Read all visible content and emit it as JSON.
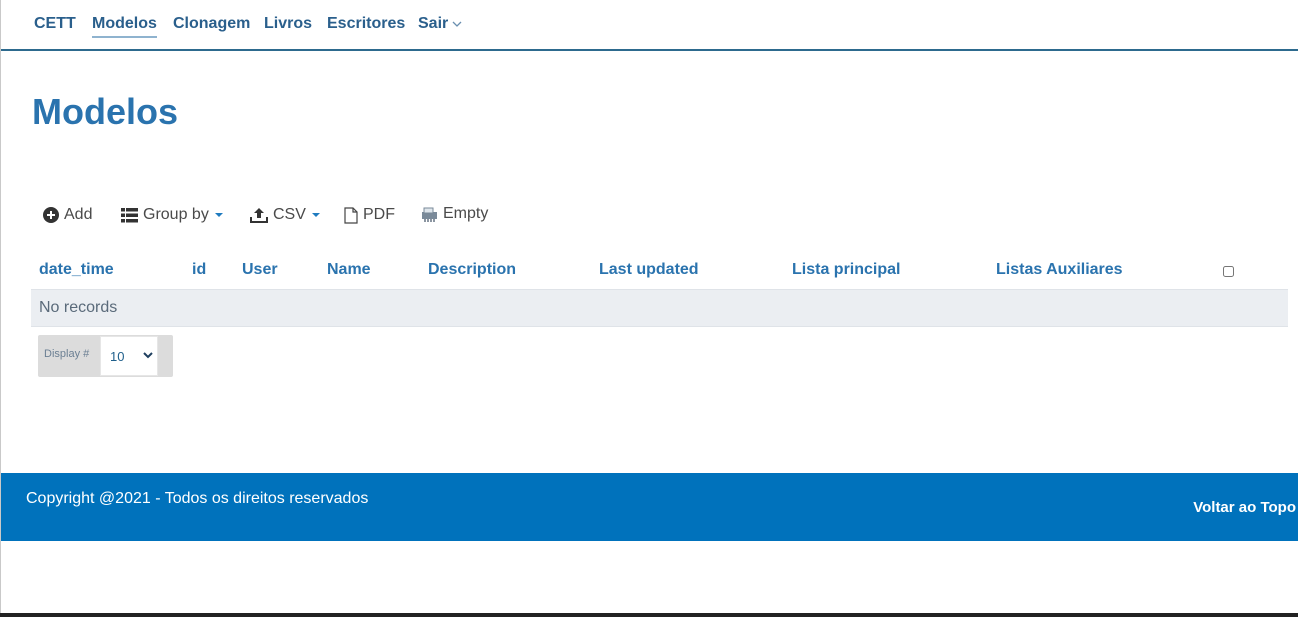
{
  "nav": {
    "brand": "CETT",
    "items": [
      "Modelos",
      "Clonagem",
      "Livros",
      "Escritores",
      "Sair"
    ]
  },
  "page_title": "Modelos",
  "toolbar": {
    "add": "Add",
    "group_by": "Group by",
    "csv": "CSV",
    "pdf": "PDF",
    "empty": "Empty"
  },
  "table": {
    "columns": [
      "date_time",
      "id",
      "User",
      "Name",
      "Description",
      "Last updated",
      "Lista principal",
      "Listas Auxiliares"
    ],
    "empty_text": "No records"
  },
  "display": {
    "label": "Display #",
    "value": "10"
  },
  "footer": {
    "copyright": "Copyright @2021 - Todos os direitos reservados",
    "back_to_top": "Voltar ao Topo"
  },
  "colors": {
    "accent": "#2a73ae",
    "footer_bg": "#0072bc",
    "row_bg": "#ebeef2"
  }
}
